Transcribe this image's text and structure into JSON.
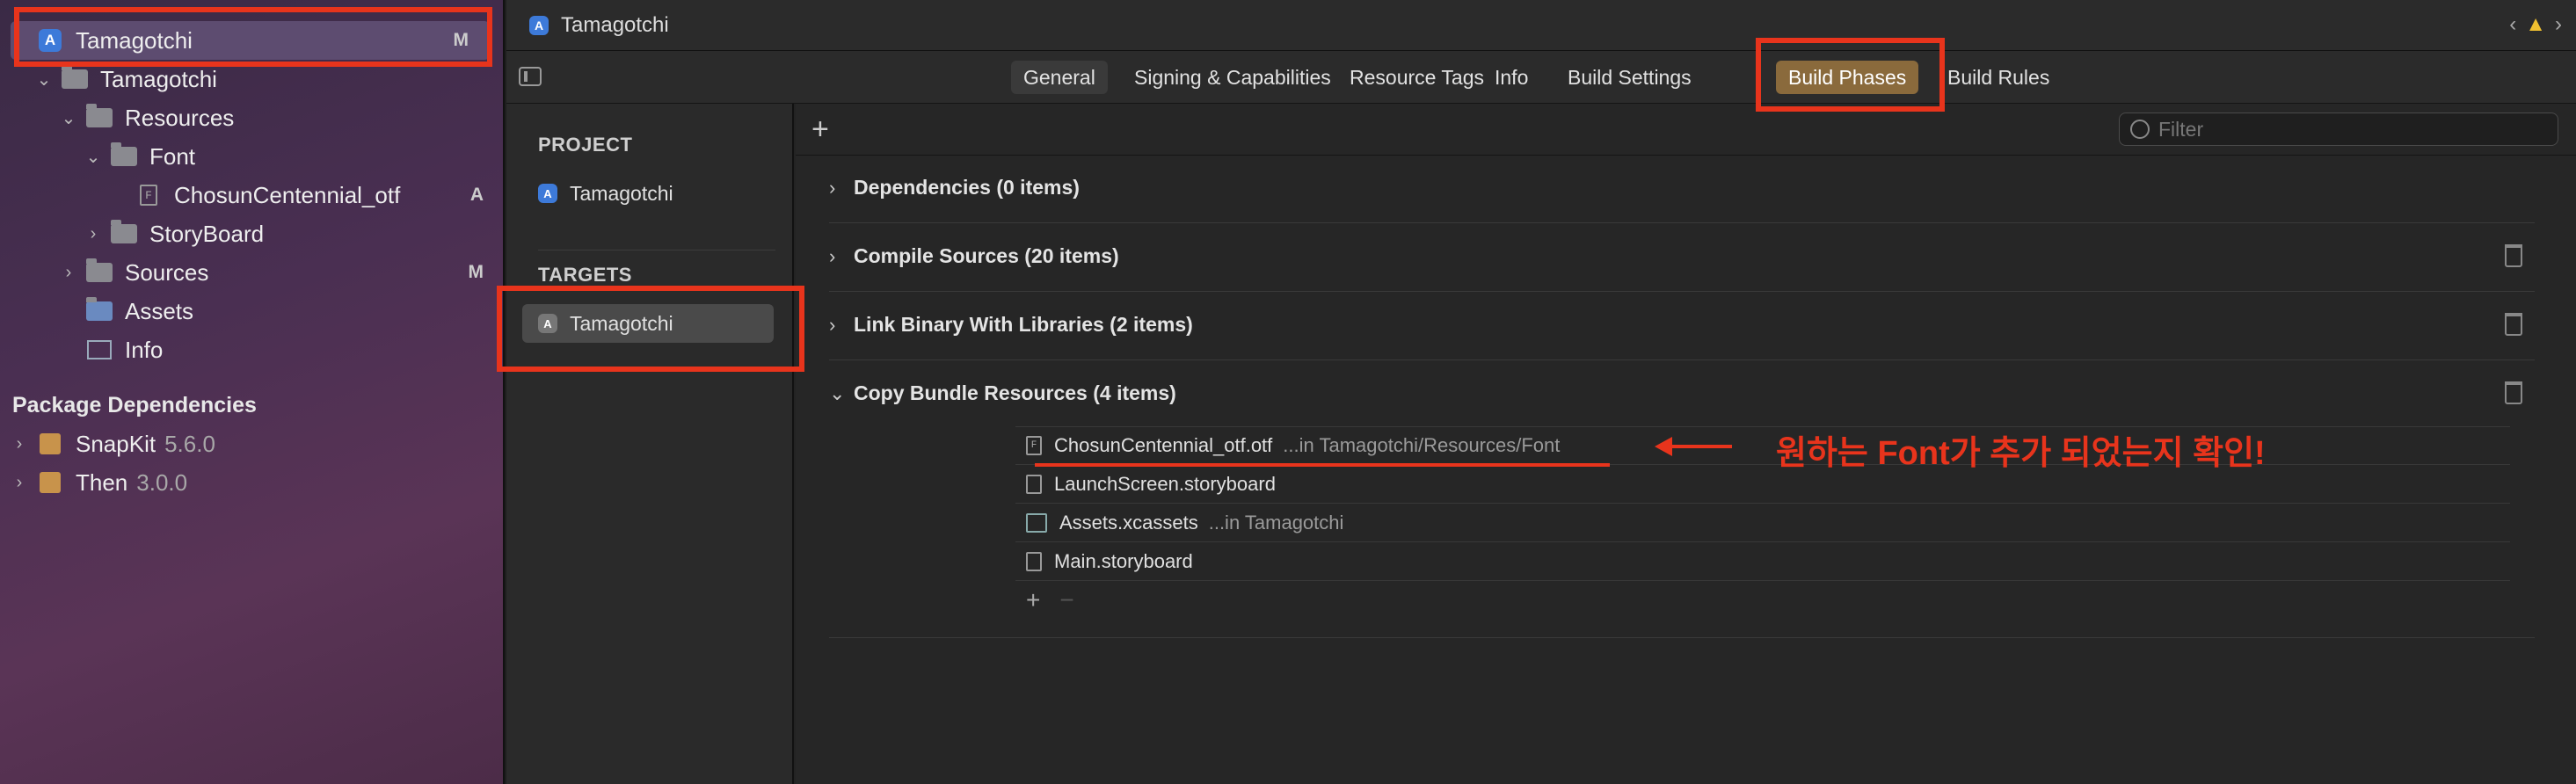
{
  "navigator": {
    "items": [
      {
        "label": "Tamagotchi",
        "badge": "M"
      },
      {
        "label": "Tamagotchi"
      },
      {
        "label": "Resources"
      },
      {
        "label": "Font"
      },
      {
        "label": "ChosunCentennial_otf",
        "badge": "A"
      },
      {
        "label": "StoryBoard"
      },
      {
        "label": "Sources",
        "badge": "M"
      },
      {
        "label": "Assets"
      },
      {
        "label": "Info"
      }
    ],
    "package_dependencies_title": "Package Dependencies",
    "packages": [
      {
        "name": "SnapKit",
        "version": "5.6.0"
      },
      {
        "name": "Then",
        "version": "3.0.0"
      }
    ]
  },
  "editor": {
    "window_title": "Tamagotchi",
    "tabs": [
      "General",
      "Signing & Capabilities",
      "Resource Tags",
      "Info",
      "Build Settings",
      "Build Phases",
      "Build Rules"
    ],
    "active_tab": "Build Phases",
    "project_header": "PROJECT",
    "project_item": "Tamagotchi",
    "targets_header": "TARGETS",
    "target_item": "Tamagotchi",
    "filter_placeholder": "Filter",
    "phases": [
      {
        "label": "Dependencies (0 items)"
      },
      {
        "label": "Compile Sources (20 items)"
      },
      {
        "label": "Link Binary With Libraries (2 items)"
      },
      {
        "label": "Copy Bundle Resources (4 items)"
      }
    ],
    "resources": [
      {
        "name": "ChosunCentennial_otf.otf",
        "path": "...in Tamagotchi/Resources/Font"
      },
      {
        "name": "LaunchScreen.storyboard",
        "path": ""
      },
      {
        "name": "Assets.xcassets",
        "path": "...in Tamagotchi"
      },
      {
        "name": "Main.storyboard",
        "path": ""
      }
    ]
  },
  "annotation": {
    "text": "원하는 Font가 추가 되었는지 확인!",
    "color": "#e8341c"
  }
}
